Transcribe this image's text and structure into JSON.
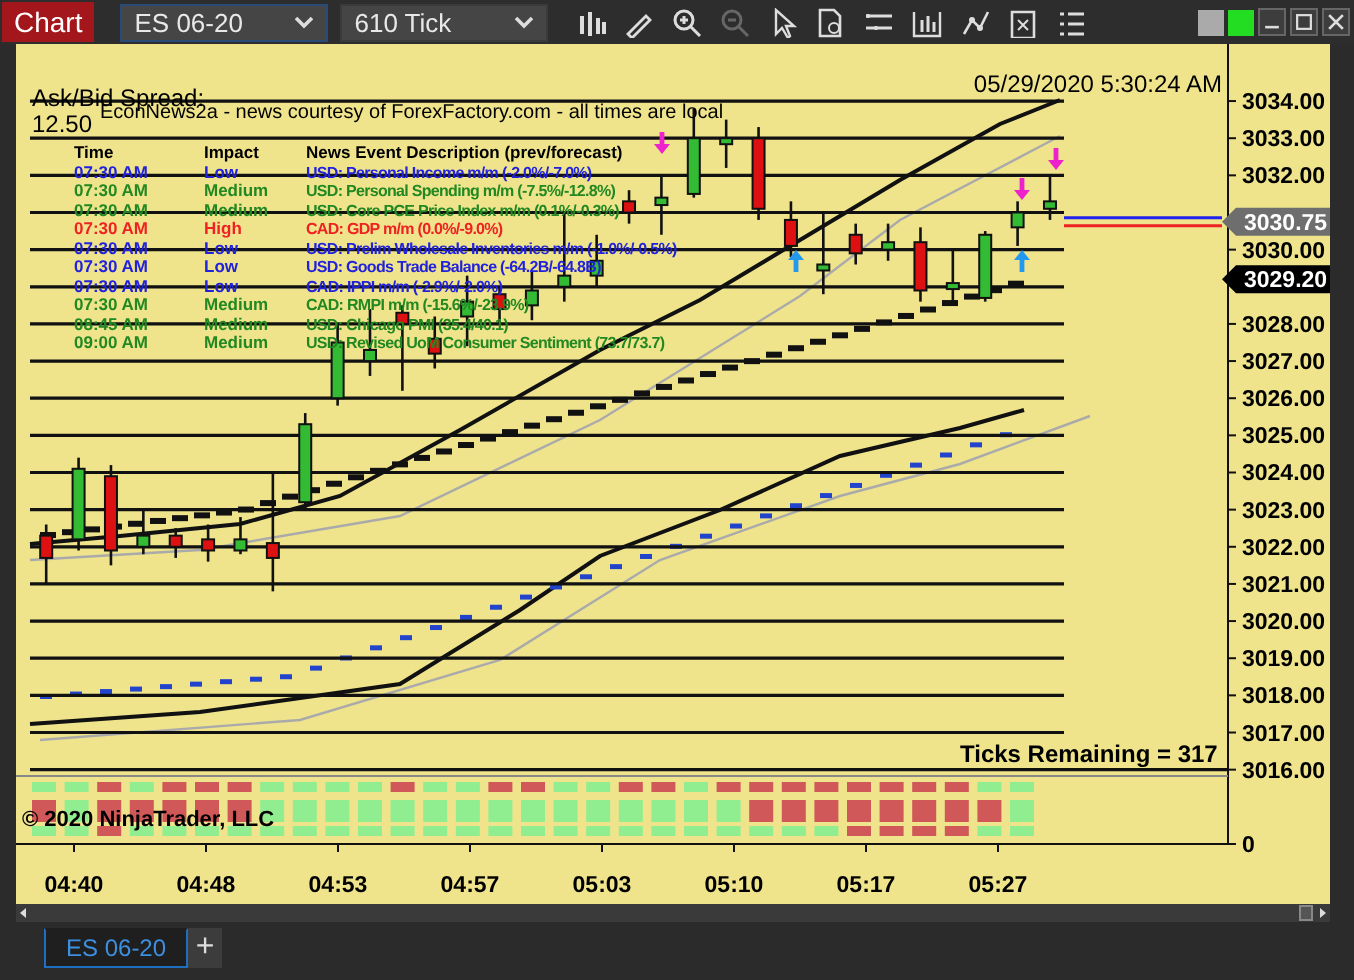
{
  "toolbar": {
    "chart_button": "Chart",
    "instrument": "ES 06-20",
    "interval": "610 Tick"
  },
  "chart": {
    "spread_label": "Ask/Bid Spread:",
    "spread_value": "12.50",
    "timestamp": "05/29/2020 5:30:24 AM",
    "news": {
      "title": "EconNews2a - news courtesy of ForexFactory.com - all times are local",
      "columns": [
        "Time",
        "Impact",
        "News Event Description (prev/forecast)"
      ],
      "rows": [
        {
          "time": "07:30 AM",
          "impact": "Low",
          "event": "USD: Personal Income m/m (-2.0%/-7.0%)",
          "color": "#2222dd"
        },
        {
          "time": "07:30 AM",
          "impact": "Medium",
          "event": "USD: Personal Spending m/m (-7.5%/-12.8%)",
          "color": "#228822"
        },
        {
          "time": "07:30 AM",
          "impact": "Medium",
          "event": "USD: Core PCE Price Index m/m (0.1%/-0.3%)",
          "color": "#228822"
        },
        {
          "time": "07:30 AM",
          "impact": "High",
          "event": "CAD: GDP m/m (0.0%/-9.0%)",
          "color": "#ee2222"
        },
        {
          "time": "07:30 AM",
          "impact": "Low",
          "event": "USD: Prelim Wholesale Inventories m/m (-1.0%/-0.5%)",
          "color": "#2222dd"
        },
        {
          "time": "07:30 AM",
          "impact": "Low",
          "event": "USD: Goods Trade Balance (-64.2B/-64.8B)",
          "color": "#2222dd"
        },
        {
          "time": "07:30 AM",
          "impact": "Low",
          "event": "CAD: IPPI m/m (-2.9%/-2.0%)",
          "color": "#2222dd"
        },
        {
          "time": "07:30 AM",
          "impact": "Medium",
          "event": "CAD: RMPI m/m (-15.6%/-23.9%)",
          "color": "#228822"
        },
        {
          "time": "08:45 AM",
          "impact": "Medium",
          "event": "USD: Chicago PMI (35.4/40.1)",
          "color": "#228822"
        },
        {
          "time": "09:00 AM",
          "impact": "Medium",
          "event": "USD: Revised UoM Consumer Sentiment (73.7/73.7)",
          "color": "#228822"
        }
      ]
    },
    "ticks_remaining": "Ticks Remaining = 317",
    "copyright": "© 2020 NinjaTrader, LLC",
    "chart_data": {
      "type": "candlestick",
      "categories": [
        null,
        null,
        null,
        null,
        null,
        null,
        null,
        null,
        null,
        null,
        null,
        null,
        null,
        null,
        null,
        null,
        null,
        null,
        null,
        null,
        null,
        null,
        null,
        null,
        null,
        null,
        null,
        null,
        null,
        null,
        null,
        null,
        null,
        null,
        null,
        null,
        null
      ],
      "ylim": [
        3014,
        3035.5
      ],
      "yticks": [
        {
          "value": 3034,
          "label": "3034.00"
        },
        {
          "value": 3033,
          "label": "3033.00"
        },
        {
          "value": 3032,
          "label": "3032.00"
        },
        {
          "value": 3030,
          "label": "3030.00"
        },
        {
          "value": 3028,
          "label": "3028.00"
        },
        {
          "value": 3027,
          "label": "3027.00"
        },
        {
          "value": 3026,
          "label": "3026.00"
        },
        {
          "value": 3025,
          "label": "3025.00"
        },
        {
          "value": 3024,
          "label": "3024.00"
        },
        {
          "value": 3023,
          "label": "3023.00"
        },
        {
          "value": 3022,
          "label": "3022.00"
        },
        {
          "value": 3021,
          "label": "3021.00"
        },
        {
          "value": 3020,
          "label": "3020.00"
        },
        {
          "value": 3019,
          "label": "3019.00"
        },
        {
          "value": 3018,
          "label": "3018.00"
        },
        {
          "value": 3017,
          "label": "3017.00"
        },
        {
          "value": 3016,
          "label": "3016.00"
        }
      ],
      "grid": true,
      "ohlc": [
        [
          3022.3,
          3022.6,
          3021,
          3021.7
        ],
        [
          3022.2,
          3024.4,
          3021.9,
          3024.1
        ],
        [
          3023.9,
          3024.2,
          3021.5,
          3021.9
        ],
        [
          3022,
          3023,
          3021.8,
          3022.3
        ],
        [
          3022.3,
          3022.5,
          3021.7,
          3022
        ],
        [
          3022.2,
          3022.6,
          3021.6,
          3021.9
        ],
        [
          3021.9,
          3022.8,
          3021.8,
          3022.2
        ],
        [
          3022.1,
          3024,
          3020.8,
          3021.7
        ],
        [
          3023.2,
          3025.6,
          3023,
          3025.3
        ],
        [
          3026,
          3028,
          3025.8,
          3027.5
        ],
        [
          3027,
          3028.4,
          3026.6,
          3027.3
        ],
        [
          3028.3,
          3028.5,
          3026.2,
          3028
        ],
        [
          3027.6,
          3028.2,
          3026.8,
          3027.2
        ],
        [
          3028.2,
          3029.3,
          3027.4,
          3028.6
        ],
        [
          3028.8,
          3029,
          3028,
          3028.4
        ],
        [
          3028.5,
          3029.4,
          3028.1,
          3028.9
        ],
        [
          3029,
          3031,
          3028.6,
          3029.3
        ],
        [
          3029.3,
          3030.4,
          3029,
          3029.7
        ],
        [
          3031.3,
          3031.6,
          3030.7,
          3031
        ],
        [
          3031.2,
          3032,
          3030.4,
          3031.4
        ],
        [
          3031.5,
          3033.8,
          3031.4,
          3033
        ],
        [
          3032.9,
          3033.5,
          3032.2,
          3033
        ],
        [
          3033,
          3033.3,
          3030.8,
          3031.1
        ],
        [
          3030.8,
          3031.3,
          3029.8,
          3030.1
        ],
        [
          3029.5,
          3031,
          3028.8,
          3029.6
        ],
        [
          3030.4,
          3030.7,
          3029.6,
          3029.9
        ],
        [
          3030,
          3030.7,
          3029.7,
          3030.2
        ],
        [
          3030.2,
          3030.6,
          3028.6,
          3028.9
        ],
        [
          3029,
          3030,
          3028.6,
          3029.1
        ],
        [
          3028.7,
          3030.5,
          3028.6,
          3030.4
        ],
        [
          3030.6,
          3031.3,
          3030.1,
          3031
        ],
        [
          3031.1,
          3032,
          3030.8,
          3031.3
        ],
        null,
        null,
        null,
        null,
        null
      ]
    },
    "ask_price": "3030.75",
    "last_price": "3029.20",
    "volume_axis": "0",
    "time_axis": [
      "04:40",
      "04:48",
      "04:53",
      "04:57",
      "05:03",
      "05:10",
      "05:17",
      "05:27"
    ]
  },
  "tabs": [
    {
      "label": "ES 06-20",
      "selected": true
    }
  ],
  "add_tab": "+"
}
